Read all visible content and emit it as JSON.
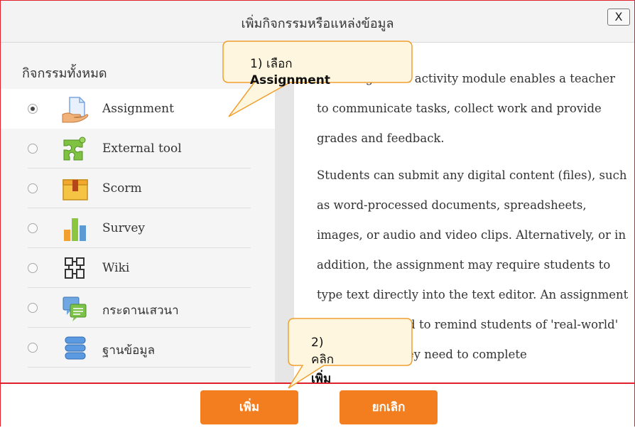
{
  "dialog": {
    "title": "เพิ่มกิจกรรมหรือแหล่งข้อมูล",
    "close_label": "X"
  },
  "sidebar": {
    "heading": "กิจกรรมทั้งหมด",
    "items": [
      {
        "label": "Assignment",
        "icon": "assignment-icon",
        "selected": true
      },
      {
        "label": "External tool",
        "icon": "external-tool-icon",
        "selected": false
      },
      {
        "label": "Scorm",
        "icon": "scorm-icon",
        "selected": false
      },
      {
        "label": "Survey",
        "icon": "survey-icon",
        "selected": false
      },
      {
        "label": "Wiki",
        "icon": "wiki-icon",
        "selected": false
      },
      {
        "label": "กระดานเสวนา",
        "icon": "forum-icon",
        "selected": false
      },
      {
        "label": "ฐานข้อมูล",
        "icon": "database-icon",
        "selected": false
      }
    ]
  },
  "description": {
    "paragraph1": "The assignment activity module enables a teacher to communicate tasks, collect work and provide grades and feedback.",
    "paragraph2": "Students can submit any digital content (files), such as word-processed documents, spreadsheets, images, or audio and video clips. Alternatively, or in addition, the assignment may require students to type text directly into the text editor. An assignment can also be used to remind students of 'real-world' assignments they need to complete"
  },
  "footer": {
    "add_label": "เพิ่ม",
    "cancel_label": "ยกเลิก"
  },
  "callouts": {
    "step1_prefix": "1) เลือก ",
    "step1_bold": "Assignment",
    "step2_prefix": "2) คลิก ",
    "step2_bold": "เพิ่ม"
  },
  "colors": {
    "accent": "#f27e1f",
    "frame": "#e0212b",
    "callout_fill": "#fef6de",
    "callout_border": "#f0a030"
  }
}
